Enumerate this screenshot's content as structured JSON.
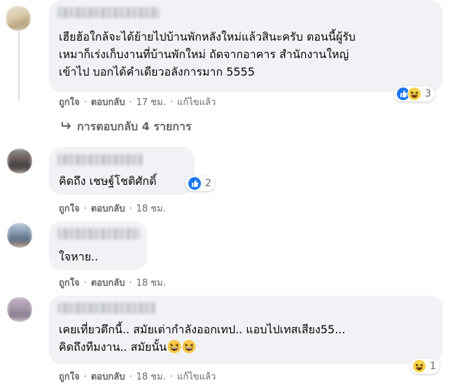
{
  "comments": [
    {
      "text": "เฮียฮ้อใกล้จะได้ย้ายไปบ้านพักหลังใหม่แล้วสินะครับ ตอนนี้ผู้รับ\nเหมาก็เร่งเก็บงานที่บ้านพักใหม่ ถัดจากอาคาร สำนักงานใหญ่\nเข้าไป บอกได้คำเดียวอลังการมาก 5555",
      "like": "ถูกใจ",
      "reply": "ตอบกลับ",
      "time": "17 ชม.",
      "edited": "แก้ไขแล้ว",
      "reaction_count": "3",
      "reaction_icons": [
        "like-icon",
        "haha-icon"
      ]
    },
    {
      "text": "คิดถึง เชษฐ์โชติศักดิ์",
      "like": "ถูกใจ",
      "reply": "ตอบกลับ",
      "time": "18 ชม.",
      "reaction_count": "2",
      "reaction_icons": [
        "like-icon"
      ]
    },
    {
      "text": "ใจหาย..",
      "like": "ถูกใจ",
      "reply": "ตอบกลับ",
      "time": "18 ชม."
    },
    {
      "text_line1": "เคยเที่ยวตึกนี้.. สมัยเต่ากำลังออกเทป.. แอบไปเทสเสียง55...",
      "text_line2": "คิดถึงทีมงาน.. สมัยนั้น",
      "inline_emoji": [
        "grinning-squint-icon",
        "grinning-squint-icon"
      ],
      "like": "ถูกใจ",
      "reply": "ตอบกลับ",
      "time": "18 ชม.",
      "edited": "แก้ไขแล้ว",
      "reaction_count": "1",
      "reaction_icons": [
        "haha-icon"
      ]
    }
  ],
  "replies_link": {
    "label": "การตอบกลับ 4 รายการ",
    "icon": "reply-arrow-icon"
  },
  "separator": "·",
  "colors": {
    "bubble": "#f0f2f5",
    "secondary_text": "#65676b",
    "like_blue": "#1877f2",
    "haha_yellow": "#f7d44a"
  }
}
